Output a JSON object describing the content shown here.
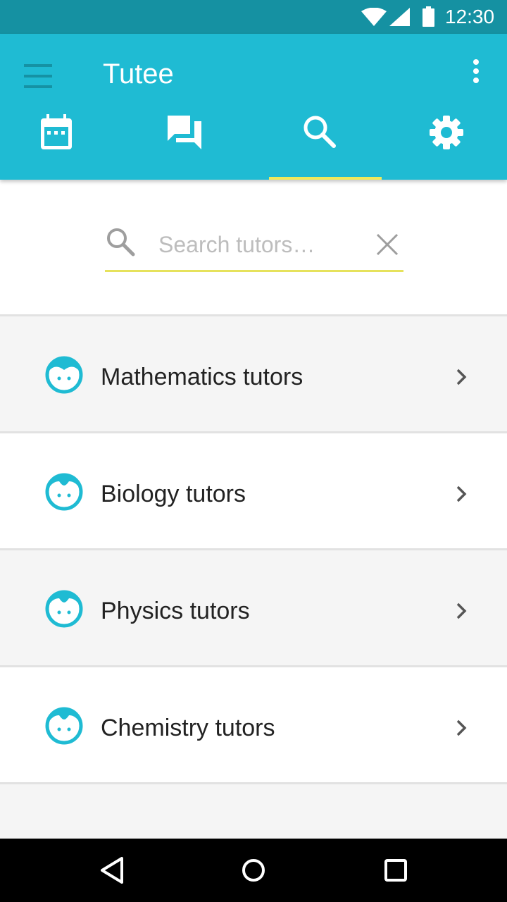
{
  "status_bar": {
    "time": "12:30",
    "icons": [
      "wifi-icon",
      "cell-signal-icon",
      "battery-icon"
    ]
  },
  "app_bar": {
    "title": "Tutee",
    "background": "#1fbbd3",
    "tabs": [
      {
        "icon": "calendar-icon",
        "selected": false
      },
      {
        "icon": "chat-icon",
        "selected": false
      },
      {
        "icon": "search-icon",
        "selected": true
      },
      {
        "icon": "settings-icon",
        "selected": false
      }
    ],
    "indicator_color": "#eeea5b"
  },
  "search": {
    "placeholder": "Search tutors…",
    "value": ""
  },
  "categories": [
    {
      "label": "Mathematics tutors",
      "icon": "tutor-face-icon"
    },
    {
      "label": "Biology tutors",
      "icon": "tutor-face-icon"
    },
    {
      "label": "Physics tutors",
      "icon": "tutor-face-icon"
    },
    {
      "label": "Chemistry tutors",
      "icon": "tutor-face-icon"
    }
  ],
  "colors": {
    "accent": "#1fbbd3",
    "status_bar": "#1591a2",
    "underline": "#e6e25c"
  }
}
